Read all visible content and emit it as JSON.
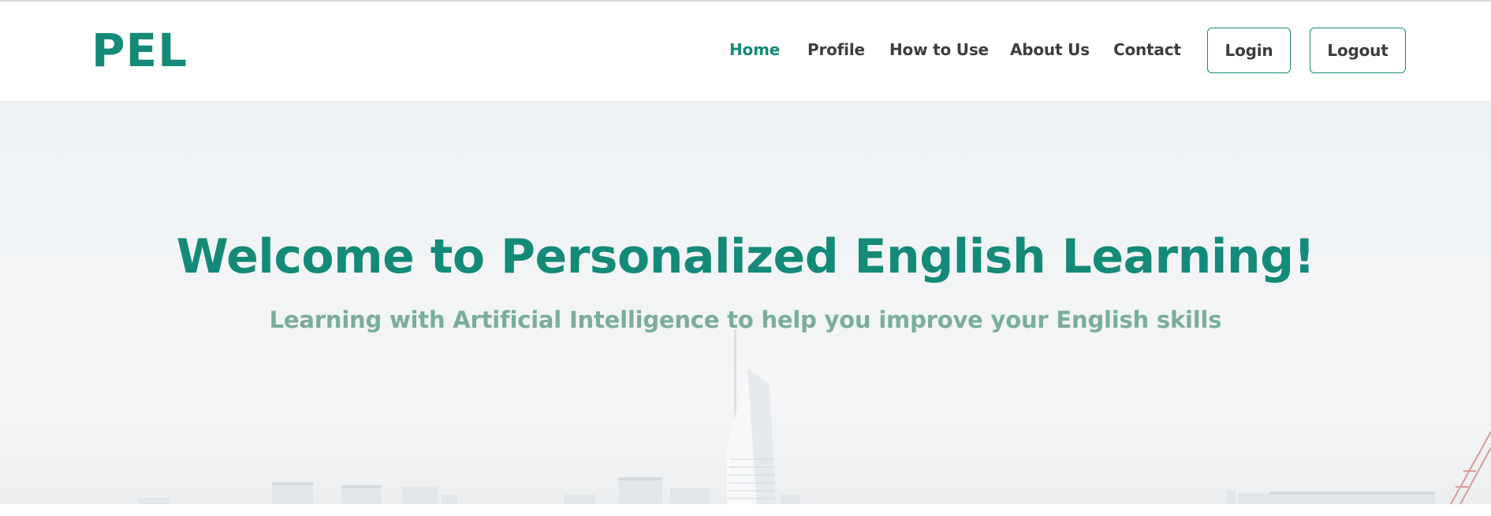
{
  "brand": {
    "logo": "PEL",
    "accent_color": "#148a78"
  },
  "nav": {
    "items": [
      {
        "label": "Home",
        "active": true
      },
      {
        "label": "Profile",
        "active": false
      },
      {
        "label": "How to Use",
        "active": false
      },
      {
        "label": "About Us",
        "active": false
      },
      {
        "label": "Contact",
        "active": false
      }
    ],
    "login_label": "Login",
    "logout_label": "Logout"
  },
  "hero": {
    "title": "Welcome to Personalized English Learning!",
    "subtitle": "Learning with Artificial Intelligence to help you improve your English skills",
    "title_color": "#148a78",
    "subtitle_color": "#7aad9c"
  }
}
